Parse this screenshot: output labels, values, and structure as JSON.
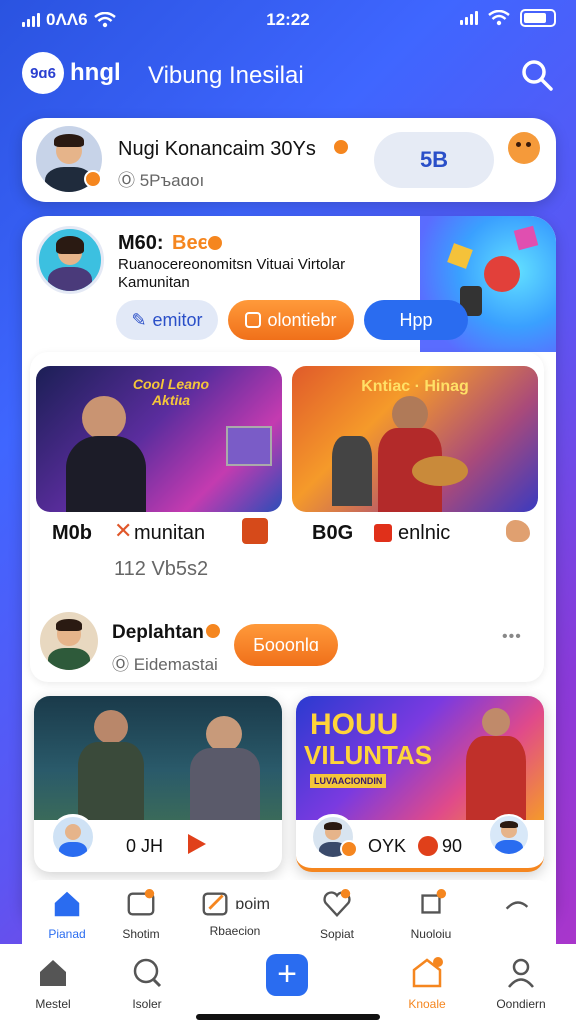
{
  "status": {
    "carrier": "0ɅɅ6",
    "time": "12:22"
  },
  "header": {
    "logo_badge": "9ɑ6",
    "logo_text": "hngl",
    "title": "Vibung Inesilai"
  },
  "profile": {
    "name": "Nugi Konancaim 30Ys",
    "handle": "Ⓞ 5Pъaɑoı",
    "count": "5B"
  },
  "feature": {
    "user": "M60:",
    "tag": "Bee",
    "desc_line1": "Ruanocereonomitsn Vituai Virtolar",
    "desc_line2": "Kamunitan",
    "buttons": [
      {
        "label": "emitor"
      },
      {
        "label": "olontiebr"
      },
      {
        "label": "Hpp"
      }
    ]
  },
  "grid1": [
    {
      "poster_text": "Cool Leano Aktiɩa",
      "label": "M0b",
      "tag": "munitan",
      "sub": "112 Vb5s2"
    },
    {
      "poster_text": "Kntiac · Hinag",
      "label": "B0G",
      "tag": "enlnic",
      "sub": ""
    }
  ],
  "creator": {
    "name": "Deplahtan",
    "handle": "Ⓞ Eidemastai",
    "button": "Боoonlɑ",
    "more": "•••"
  },
  "grid2": [
    {
      "footer": "0 JH"
    },
    {
      "poster_line1": "HOUU",
      "poster_line2": "VILUNTAS",
      "poster_line3": "LUVAACIONDIN",
      "footer": "OYK",
      "footer2": "90"
    }
  ],
  "upper_tabs": [
    {
      "label": "Pianad"
    },
    {
      "label": "Shotim"
    },
    {
      "label": "Rbaecion",
      "extra": "ɒoim"
    },
    {
      "label": "Sopiat"
    },
    {
      "label": "Nuoloiu"
    },
    {
      "label": ""
    }
  ],
  "tabs": [
    {
      "label": "Mestel"
    },
    {
      "label": "Isoler"
    },
    {
      "label": ""
    },
    {
      "label": "Knoale"
    },
    {
      "label": "Oondiern"
    }
  ],
  "colors": {
    "accent": "#f5861f",
    "primary": "#2a6cf0",
    "active_tab": "#2a6cf0"
  }
}
